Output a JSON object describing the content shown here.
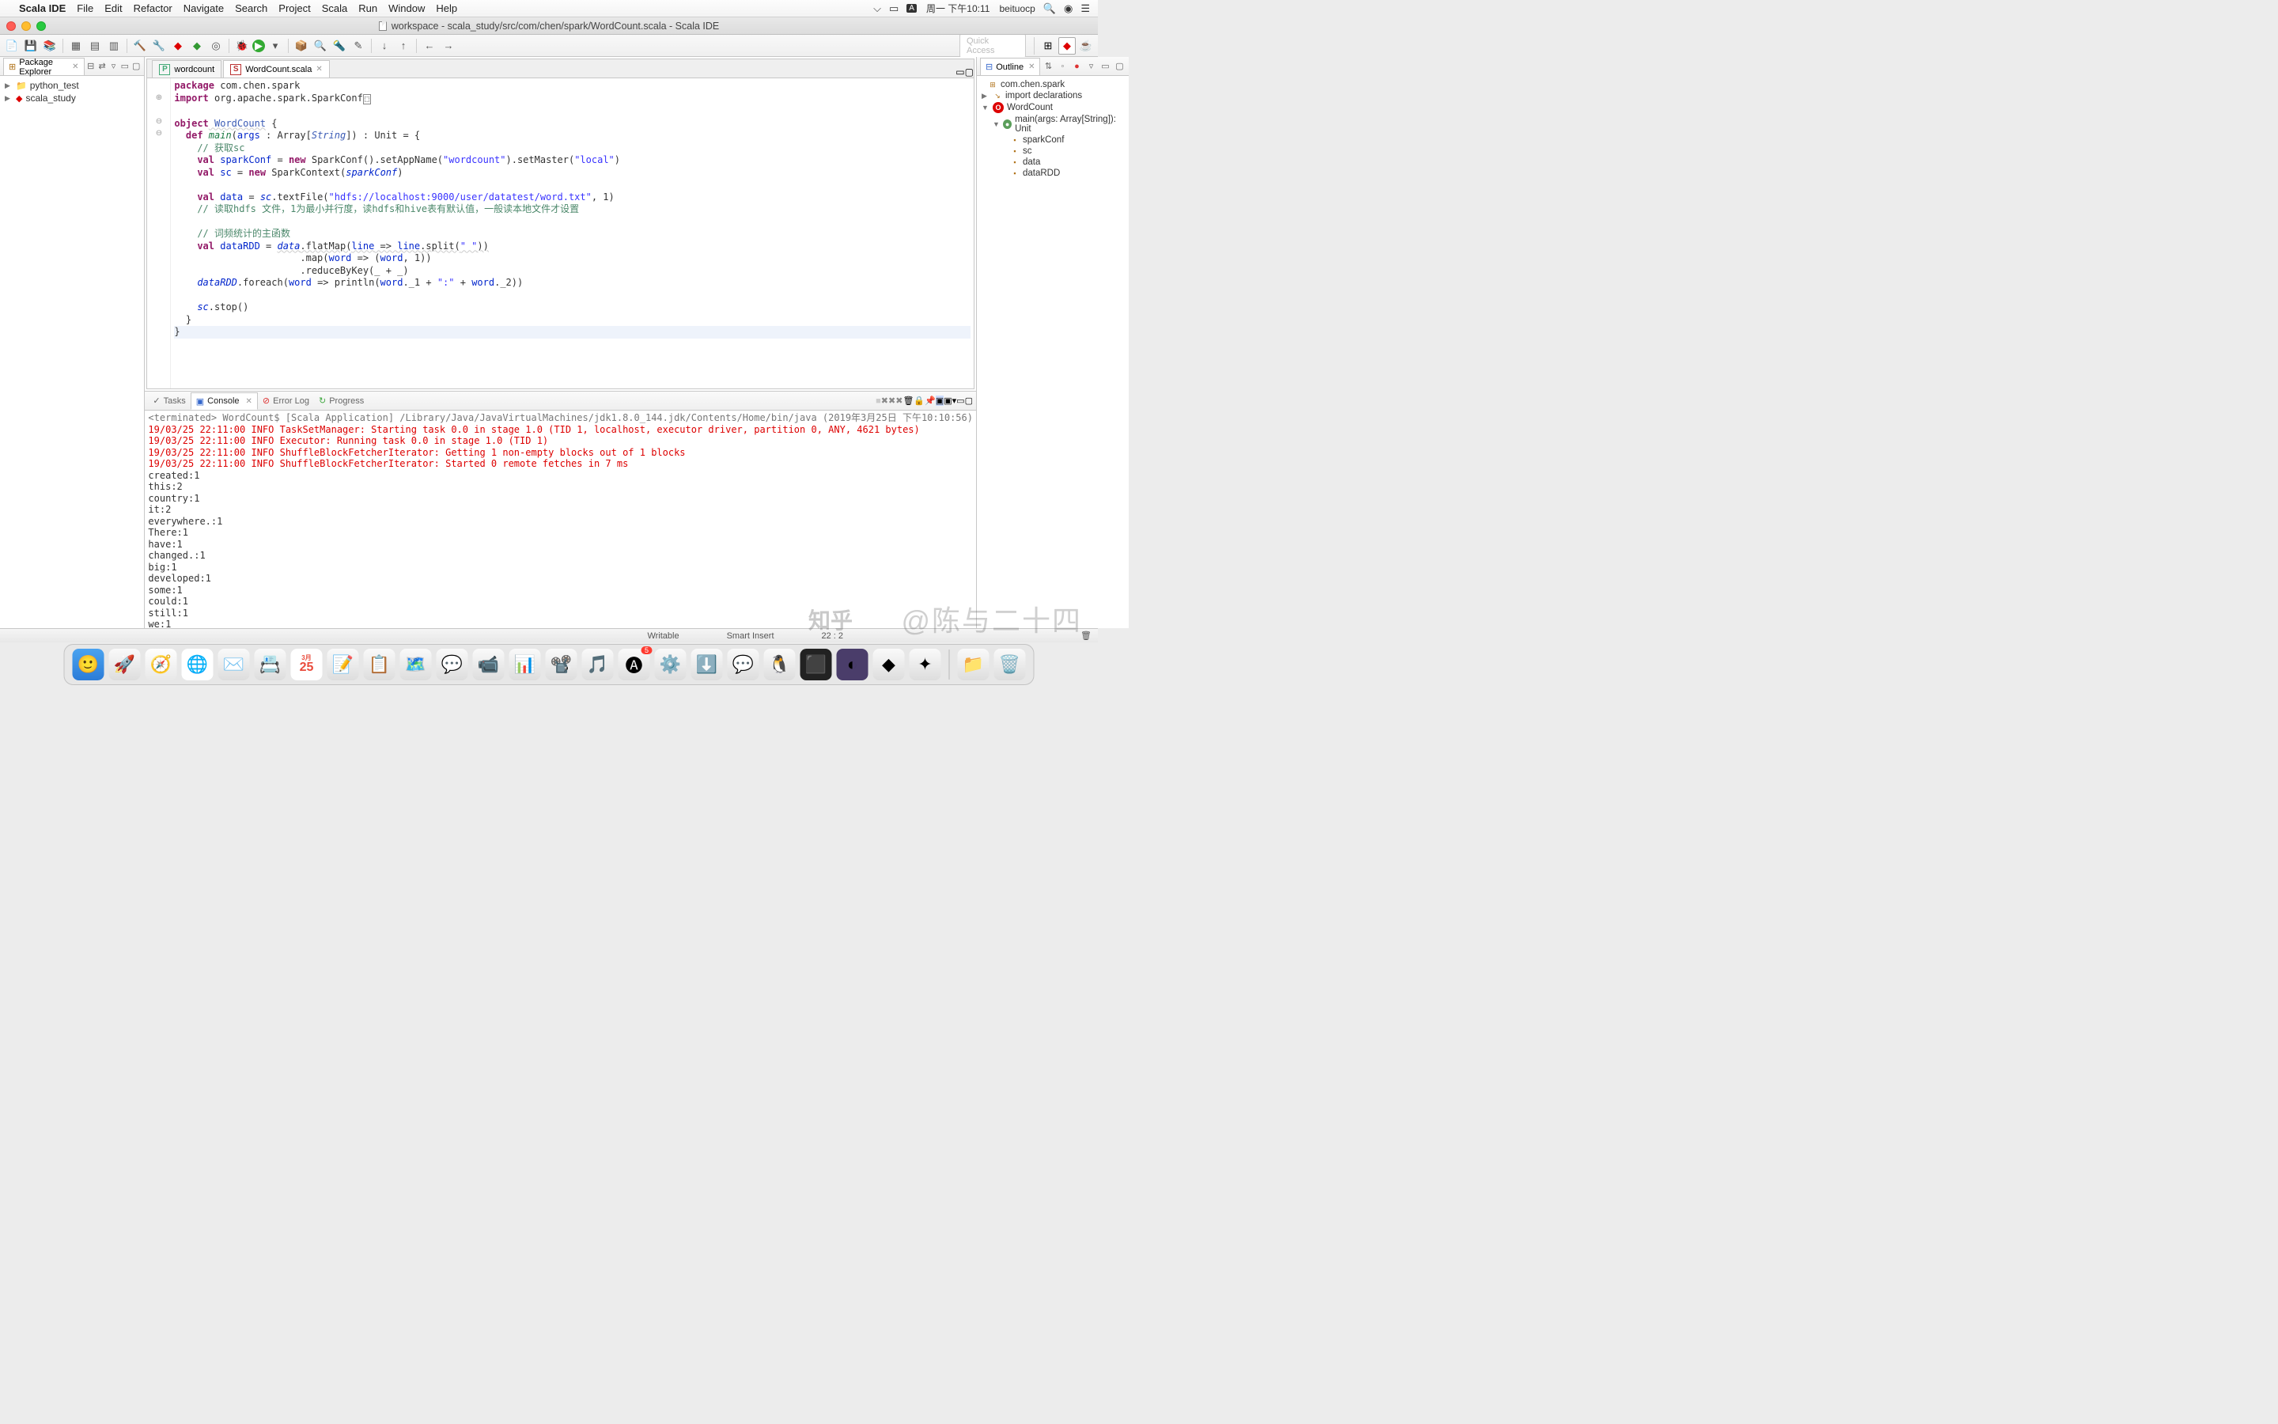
{
  "menubar": {
    "app": "Scala IDE",
    "items": [
      "File",
      "Edit",
      "Refactor",
      "Navigate",
      "Search",
      "Project",
      "Scala",
      "Run",
      "Window",
      "Help"
    ],
    "clock": "周一 下午10:11",
    "user": "beituocp"
  },
  "window": {
    "title": "workspace - scala_study/src/com/chen/spark/WordCount.scala - Scala IDE"
  },
  "quick_access": "Quick Access",
  "package_explorer": {
    "title": "Package Explorer",
    "items": [
      "python_test",
      "scala_study"
    ]
  },
  "editor_tabs": {
    "tab1": "wordcount",
    "tab2": "WordCount.scala"
  },
  "code": {
    "l1a": "package",
    "l1b": " com.chen.spark",
    "l2a": "import",
    "l2b": " org.apache.spark.SparkConf",
    "l4a": "object",
    "l4b": " WordCount",
    "l4c": " {",
    "l5a": "  def",
    "l5b": " main",
    "l5c": "(",
    "l5d": "args",
    "l5e": " : Array[",
    "l5f": "String",
    "l5g": "]) : Unit = {",
    "l6": "    // 获取sc",
    "l7a": "    val",
    "l7b": " sparkConf",
    "l7c": " = ",
    "l7d": "new",
    "l7e": " SparkConf().setAppName(",
    "l7f": "\"wordcount\"",
    "l7g": ").setMaster(",
    "l7h": "\"local\"",
    "l7i": ")",
    "l8a": "    val",
    "l8b": " sc",
    "l8c": " = ",
    "l8d": "new",
    "l8e": " SparkContext(",
    "l8f": "sparkConf",
    "l8g": ")",
    "l10a": "    val",
    "l10b": " data",
    "l10c": " = ",
    "l10d": "sc",
    "l10e": ".textFile(",
    "l10f": "\"hdfs://localhost:9000/user/datatest/word.txt\"",
    "l10g": ", 1)",
    "l11": "    // 读取hdfs 文件，1为最小并行度，读hdfs和hive表有默认值，一般读本地文件才设置",
    "l13": "    // 词频统计的主函数",
    "l14a": "    val",
    "l14b": " dataRDD",
    "l14c": " = ",
    "l14d": "data",
    "l14e": ".flatMap(",
    "l14f": "line",
    "l14g": " => ",
    "l14h": "line",
    "l14i": ".split(",
    "l14j": "\" \"",
    "l14k": "))",
    "l15a": "                      .map(",
    "l15b": "word",
    "l15c": " => (",
    "l15d": "word",
    "l15e": ", 1))",
    "l16": "                      .reduceByKey(_ + _)",
    "l17a": "    ",
    "l17b": "dataRDD",
    "l17c": ".foreach(",
    "l17d": "word",
    "l17e": " => println(",
    "l17f": "word",
    "l17g": "._1 + ",
    "l17h": "\":\"",
    "l17i": " + ",
    "l17j": "word",
    "l17k": "._2))",
    "l19a": "    ",
    "l19b": "sc",
    "l19c": ".stop()",
    "l20": "  }",
    "l21": "}"
  },
  "outline": {
    "title": "Outline",
    "pkg": "com.chen.spark",
    "imp": "import declarations",
    "obj": "WordCount",
    "main": "main(args: Array[String]): Unit",
    "v1": "sparkConf",
    "v2": "sc",
    "v3": "data",
    "v4": "dataRDD"
  },
  "bottom": {
    "tasks": "Tasks",
    "console": "Console",
    "errorlog": "Error Log",
    "progress": "Progress"
  },
  "console": {
    "terminated": "<terminated> WordCount$ [Scala Application] /Library/Java/JavaVirtualMachines/jdk1.8.0_144.jdk/Contents/Home/bin/java (2019年3月25日 下午10:10:56)",
    "log1": "19/03/25 22:11:00 INFO TaskSetManager: Starting task 0.0 in stage 1.0 (TID 1, localhost, executor driver, partition 0, ANY, 4621 bytes)",
    "log2": "19/03/25 22:11:00 INFO Executor: Running task 0.0 in stage 1.0 (TID 1)",
    "log3": "19/03/25 22:11:00 INFO ShuffleBlockFetcherIterator: Getting 1 non-empty blocks out of 1 blocks",
    "log4": "19/03/25 22:11:00 INFO ShuffleBlockFetcherIterator: Started 0 remote fetches in 7 ms",
    "out": [
      "created:1",
      "this:2",
      "country:1",
      "it:2",
      "everywhere.:1",
      "There:1",
      "have:1",
      "changed.:1",
      "big:1",
      "developed:1",
      "some:1",
      "could:1",
      "still:1",
      "we:1"
    ]
  },
  "status": {
    "writable": "Writable",
    "insert": "Smart Insert",
    "pos": "22 : 2"
  },
  "dock": {
    "cal_month": "3月",
    "cal_day": "25",
    "badge": "5"
  },
  "watermark": "@陈与二十四"
}
